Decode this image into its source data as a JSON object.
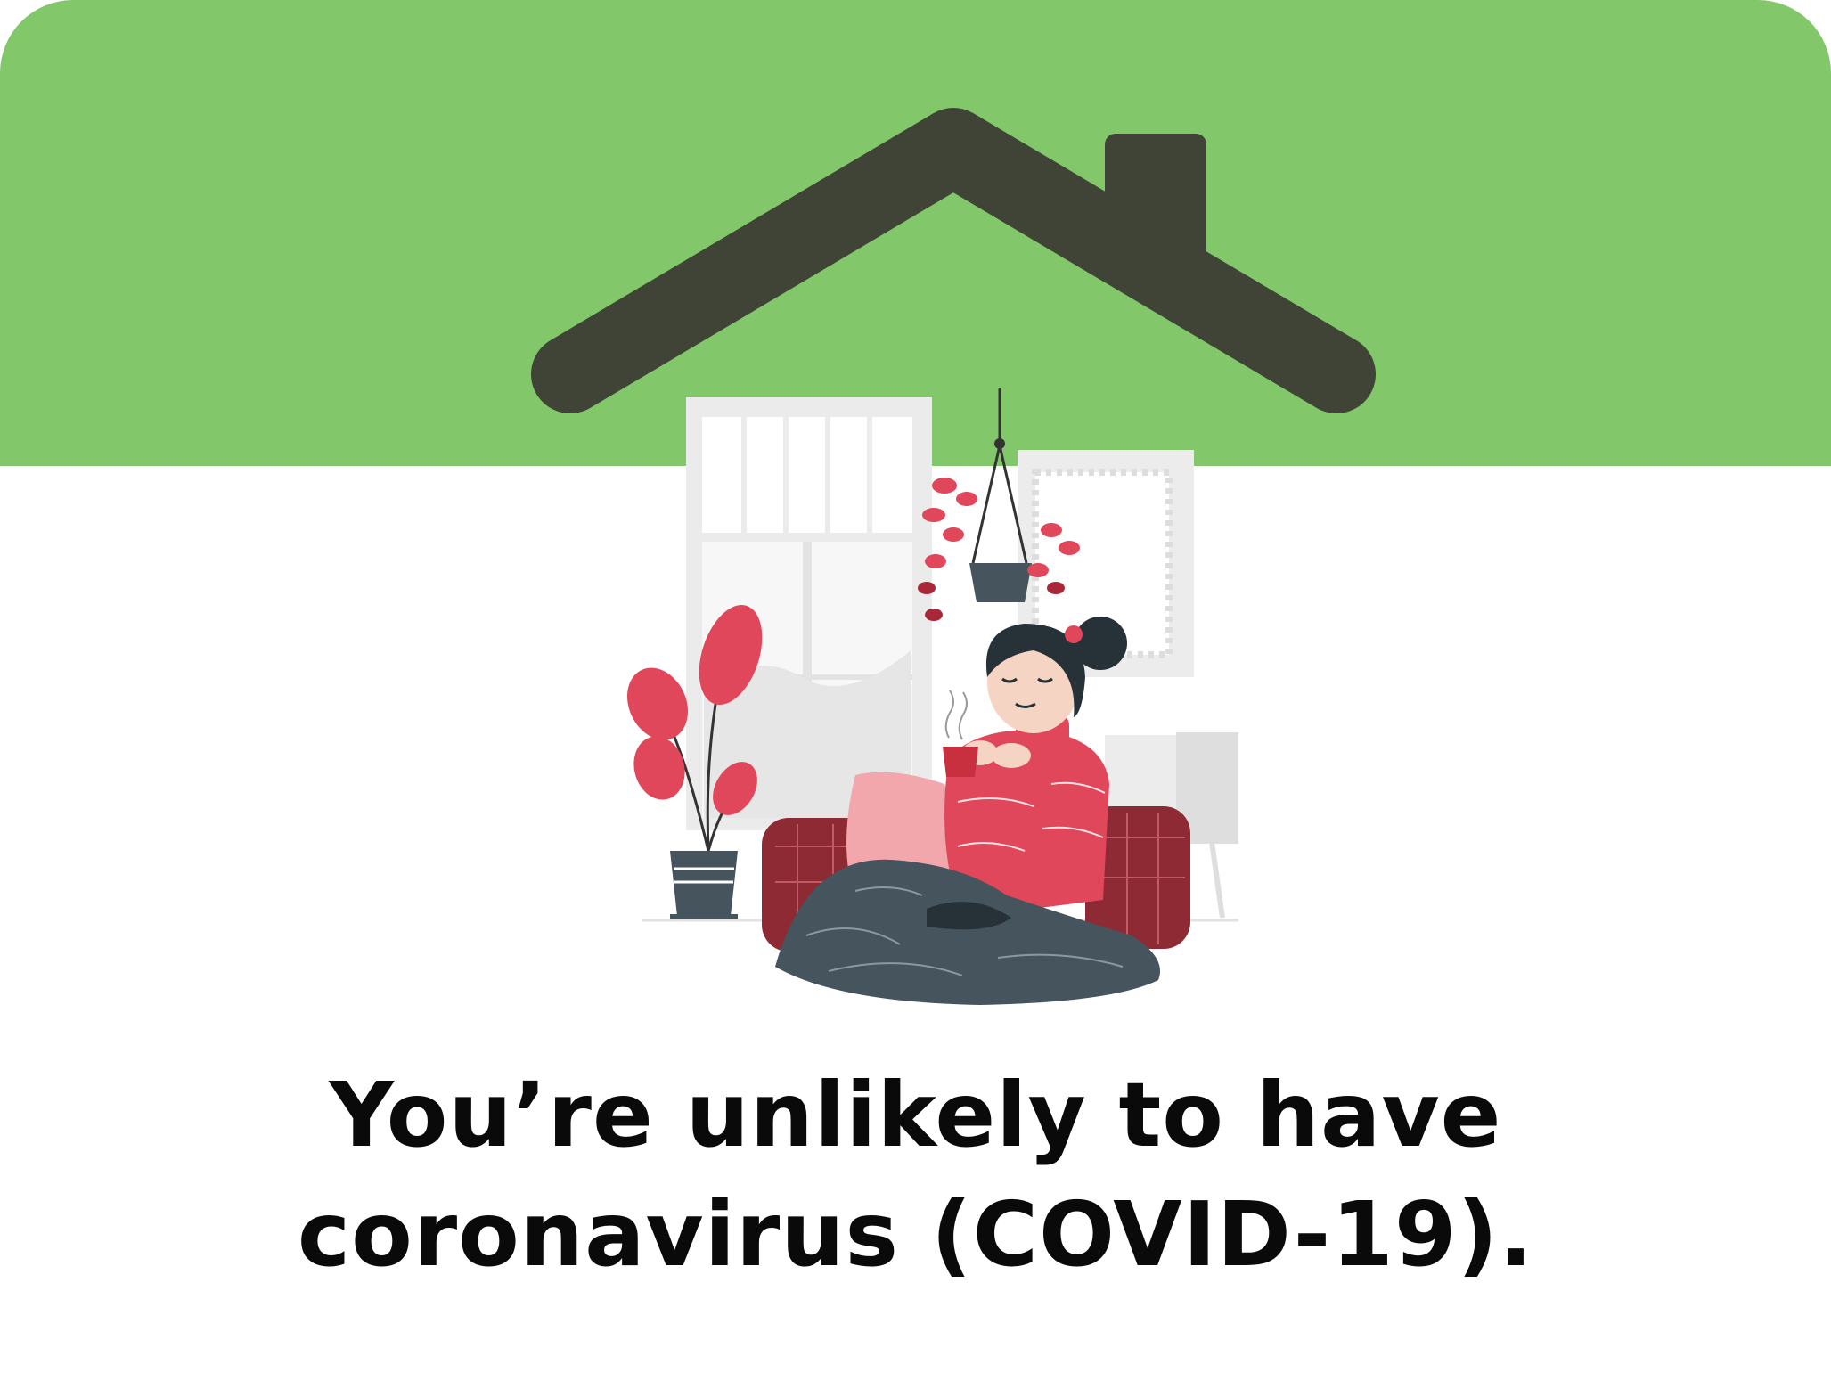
{
  "message": {
    "line1": "You’re unlikely to have",
    "line2": "coronavirus (COVID-19)."
  },
  "illustration": {
    "icon": "stay-home-illustration"
  },
  "colors": {
    "header_green": "#82c86b",
    "roof": "#3f4436",
    "accent_red": "#e0475a",
    "blanket": "#46545e",
    "sofa": "#8e2a33",
    "text": "#0a0a0a"
  }
}
